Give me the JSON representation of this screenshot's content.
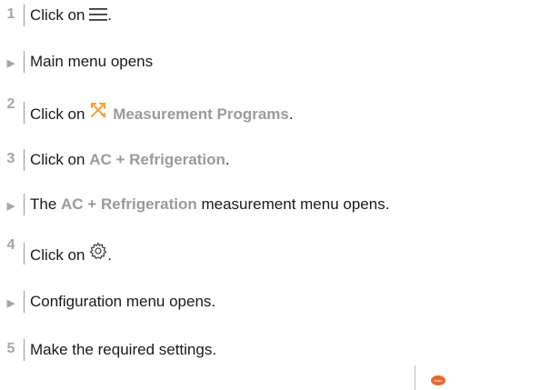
{
  "colors": {
    "highlight": "#9a9a9a",
    "marker": "#a6a6a6",
    "icon_orange": "#f2a23a",
    "logo_orange": "#e8682a"
  },
  "steps": [
    {
      "marker": "1",
      "parts": [
        "Click on ",
        "."
      ],
      "icon": "hamburger-menu-icon"
    },
    {
      "marker": "▶",
      "text": "Main menu opens"
    },
    {
      "marker": "2",
      "parts": [
        "Click on ",
        "Measurement Programs",
        "."
      ],
      "icon": "measurement-programs-icon"
    },
    {
      "marker": "3",
      "parts": [
        "Click on ",
        "AC + Refrigeration",
        "."
      ]
    },
    {
      "marker": "▶",
      "parts": [
        "The ",
        "AC + Refrigeration",
        " measurement menu opens."
      ]
    },
    {
      "marker": "4",
      "parts": [
        "Click on ",
        "."
      ],
      "icon": "gear-icon"
    },
    {
      "marker": "▶",
      "text": "Configuration menu opens."
    },
    {
      "marker": "5",
      "text": "Make the required settings."
    }
  ],
  "device_logo": {
    "text": "testo",
    "icon": "testo-logo-icon"
  }
}
